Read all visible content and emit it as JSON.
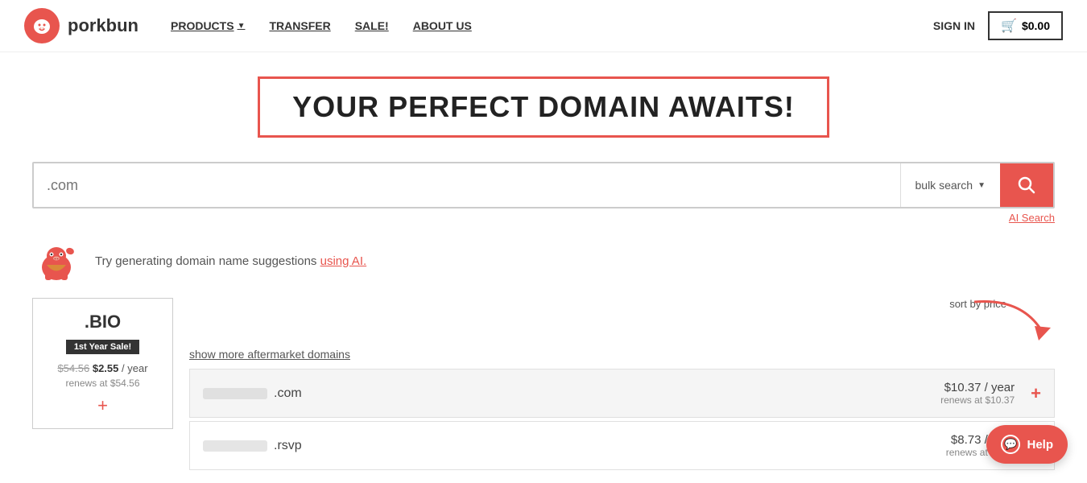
{
  "navbar": {
    "logo_text": "porkbun",
    "logo_icon": "🐷",
    "nav_links": [
      {
        "label": "PRODUCTS",
        "has_dropdown": true
      },
      {
        "label": "TRANSFER",
        "has_dropdown": false
      },
      {
        "label": "SALE!",
        "has_dropdown": false
      },
      {
        "label": "ABOUT US",
        "has_dropdown": false
      }
    ],
    "sign_in_label": "SIGN IN",
    "cart_label": "$0.00"
  },
  "hero": {
    "title": "YOUR PERFECT DOMAIN AWAITS!"
  },
  "search": {
    "placeholder": ".com",
    "bulk_search_label": "bulk search",
    "search_button_label": "Search",
    "ai_search_label": "AI Search"
  },
  "ai_suggestion": {
    "text": "Try generating domain name suggestions ",
    "link_text": "using AI."
  },
  "results": {
    "sort_label": "sort by price",
    "show_more_label": "show more aftermarket domains",
    "domains": [
      {
        "name_blur": true,
        "tld": ".com",
        "price": "$10.37 / year",
        "renews": "renews at $10.37"
      },
      {
        "name_blur": true,
        "tld": ".rsvp",
        "price": "$8.73 / year",
        "renews": "renews at $8.73"
      }
    ]
  },
  "sidebar": {
    "tld": ".BIO",
    "badge": "1st Year Sale!",
    "original_price": "$54.56",
    "new_price": "$2.55",
    "per_year": " / year",
    "renews": "renews at $54.56"
  },
  "help": {
    "label": "Help"
  }
}
